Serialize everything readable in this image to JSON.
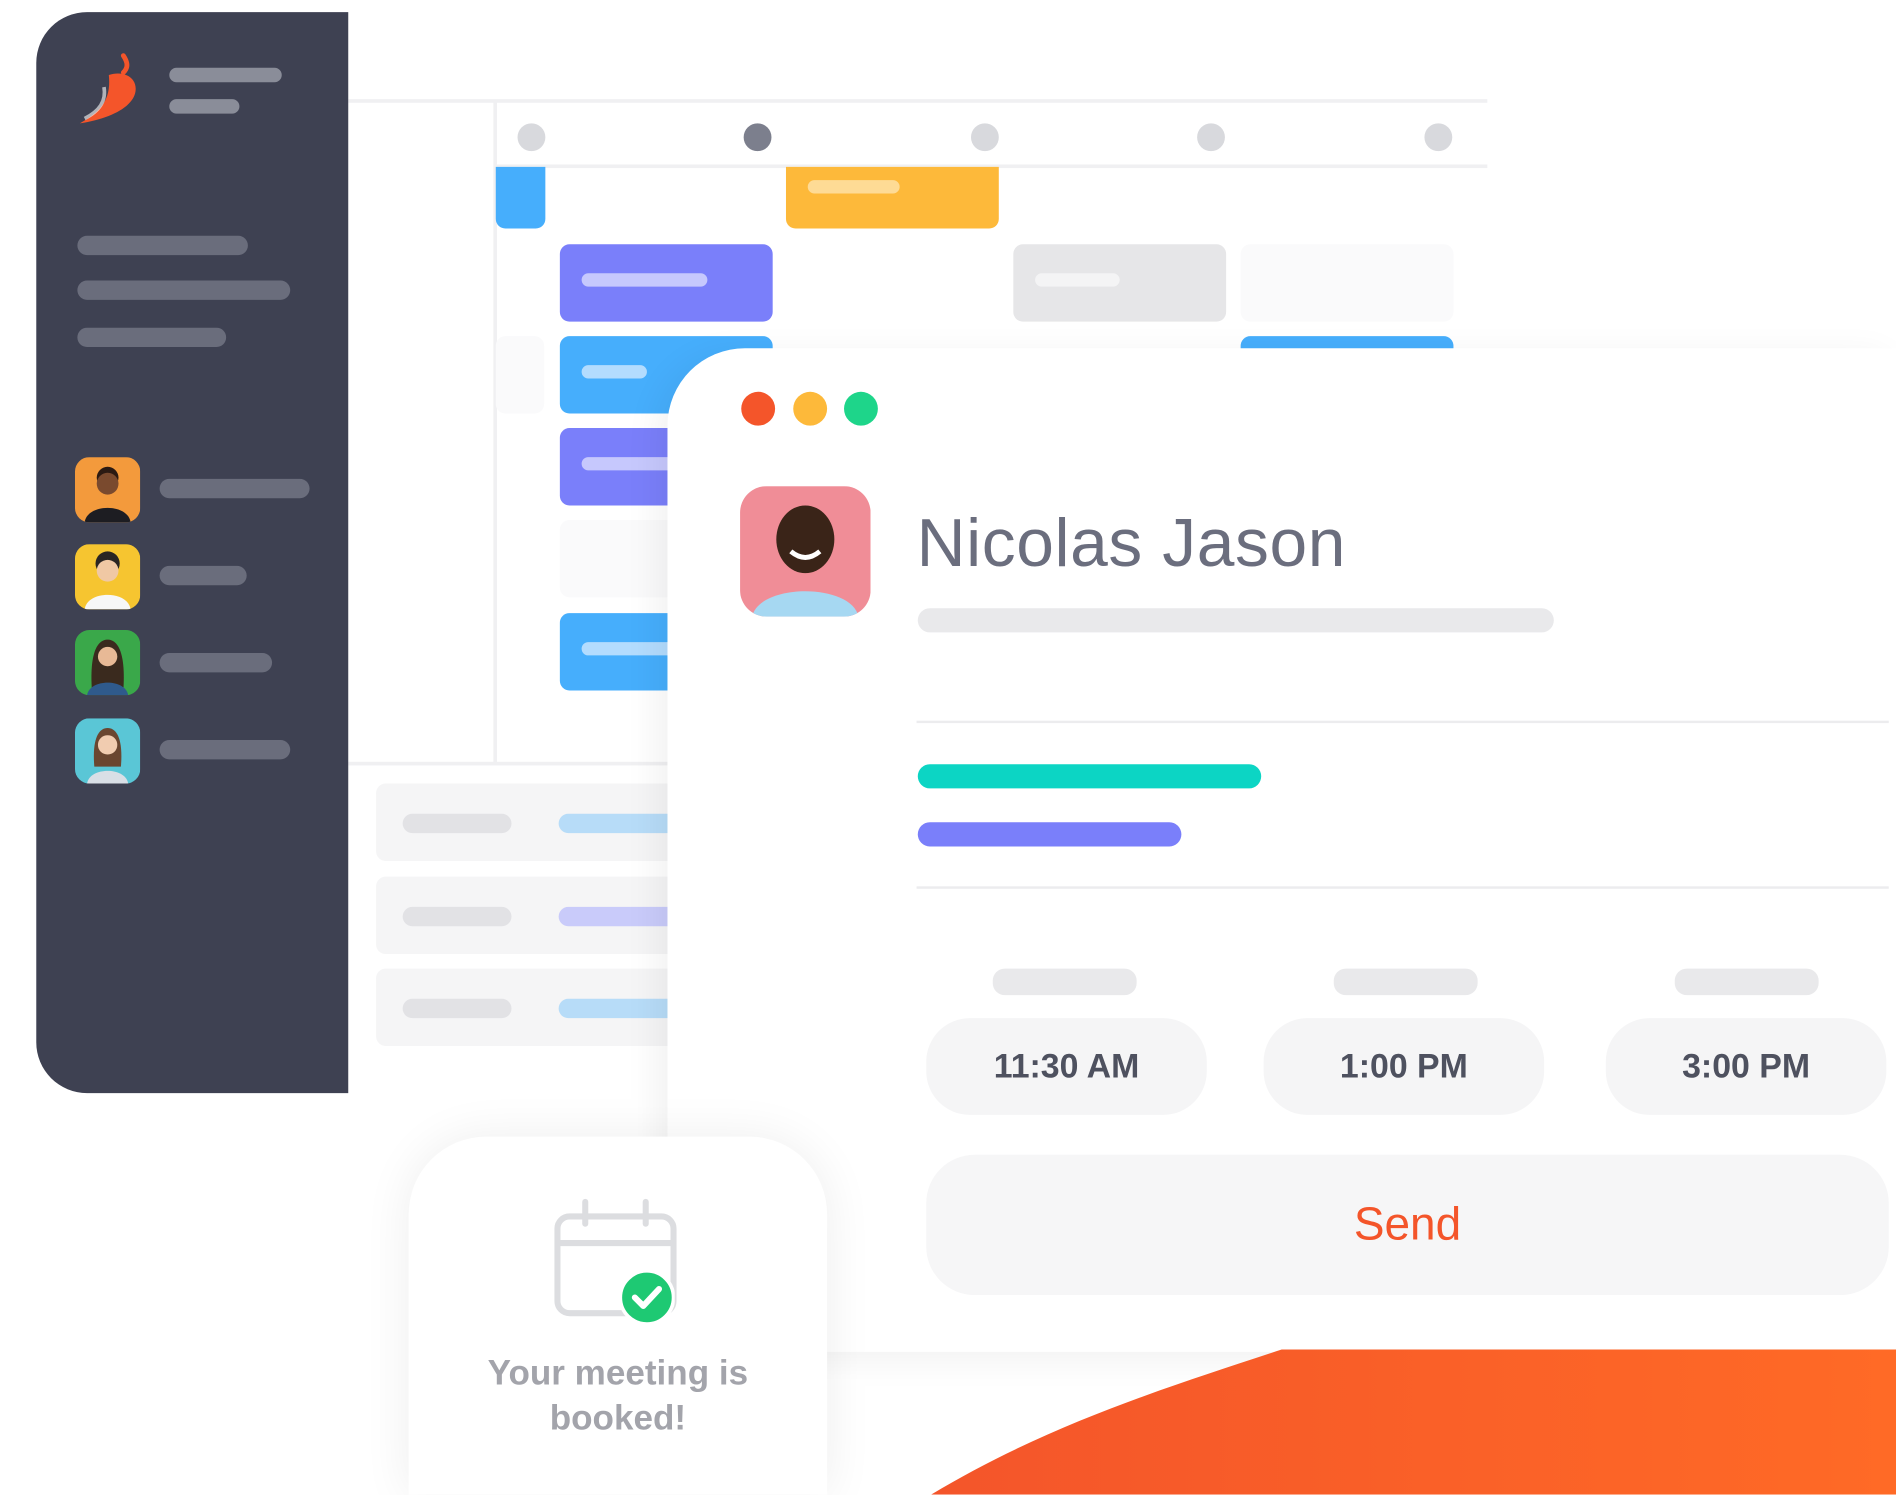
{
  "colors": {
    "sidebar": "#3e4152",
    "brand_orange": "#f4552a",
    "accent_teal": "#0cd5c4",
    "accent_indigo": "#7a7ffa",
    "accent_blue": "#46aefc",
    "accent_yellow": "#fdb93a"
  },
  "icons": {
    "logo": "chili-pepper-icon",
    "success": "check-circle-icon",
    "calendar": "calendar-icon"
  },
  "calendar": {
    "active_day_index": 1
  },
  "contact": {
    "name": "Nicolas Jason"
  },
  "time_slots": [
    "11:30 AM",
    "1:00 PM",
    "3:00 PM"
  ],
  "send_label": "Send",
  "booked_message": {
    "line1": "Your meeting is",
    "line2": "booked!"
  }
}
